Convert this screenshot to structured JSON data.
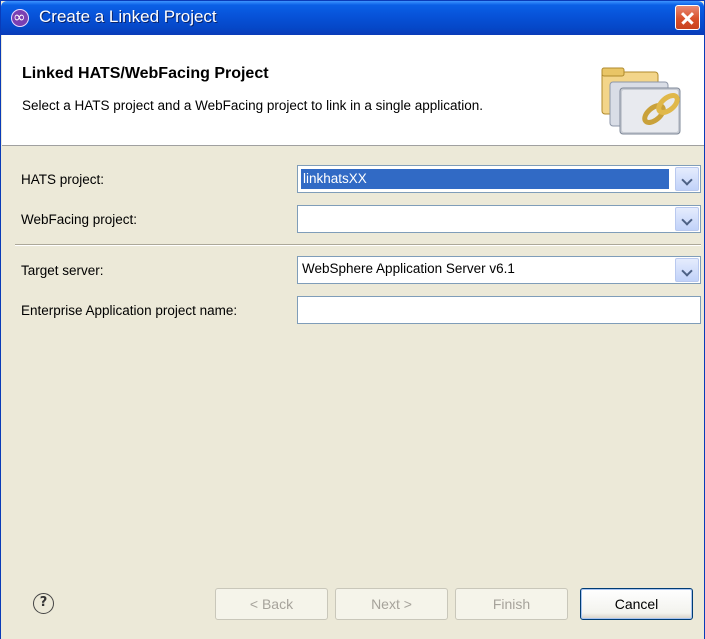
{
  "window": {
    "title": "Create a Linked Project",
    "icon": "linked-project-icon",
    "close_icon": "close-icon"
  },
  "banner": {
    "title": "Linked HATS/WebFacing Project",
    "description": "Select a HATS project and a WebFacing project to link in a single application.",
    "art_icon": "linked-folders-icon"
  },
  "form": {
    "hats_project": {
      "label": "HATS project:",
      "value": "linkhatsXX"
    },
    "webfacing_project": {
      "label": "WebFacing project:",
      "value": ""
    },
    "target_server": {
      "label": "Target server:",
      "value": "WebSphere Application Server v6.1"
    },
    "ear_project": {
      "label": "Enterprise Application project name:",
      "value": ""
    }
  },
  "footer": {
    "help_icon": "help-icon",
    "help_glyph": "?",
    "back_label": "< Back",
    "next_label": "Next >",
    "finish_label": "Finish",
    "cancel_label": "Cancel"
  }
}
